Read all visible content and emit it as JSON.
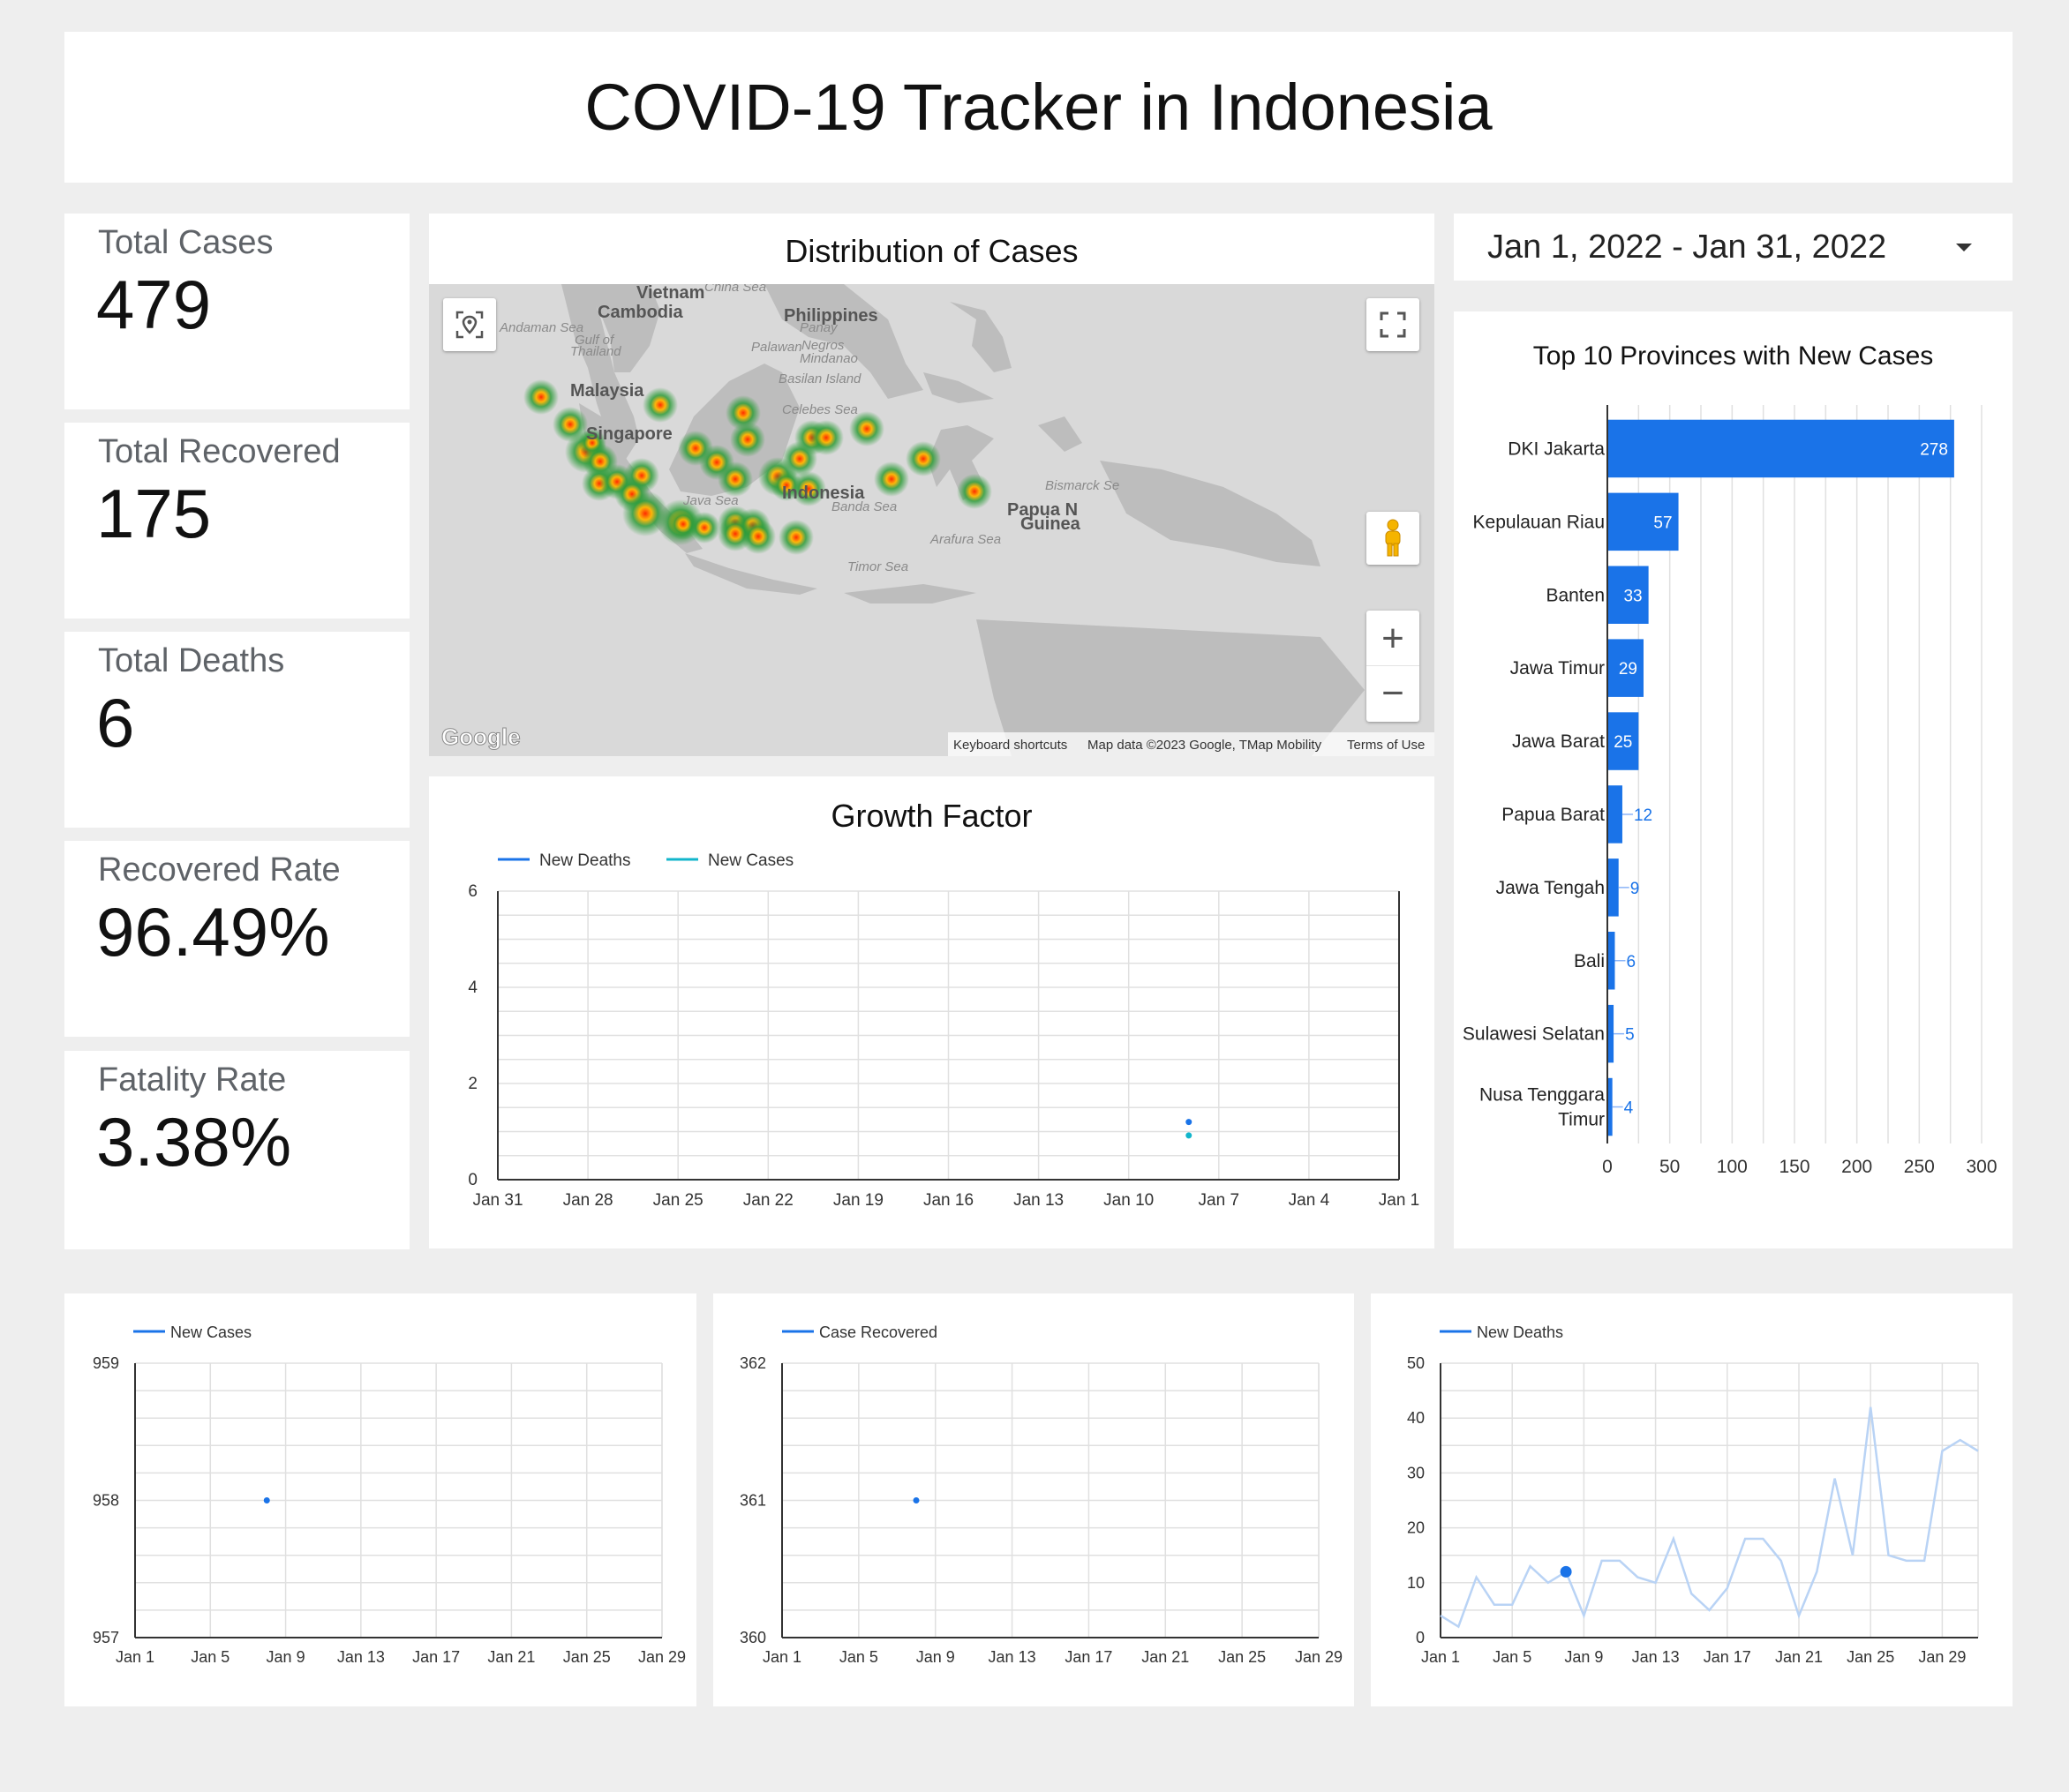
{
  "header": {
    "title": "COVID-19 Tracker in Indonesia"
  },
  "kpis": [
    {
      "label": "Total Cases",
      "value": "479"
    },
    {
      "label": "Total Recovered",
      "value": "175"
    },
    {
      "label": "Total Deaths",
      "value": "6"
    },
    {
      "label": "Recovered Rate",
      "value": "96.49%"
    },
    {
      "label": "Fatality Rate",
      "value": "3.38%"
    }
  ],
  "map": {
    "title": "Distribution of Cases",
    "labels": {
      "vietnam": "Vietnam",
      "china_sea": "China Sea",
      "cambodia": "Cambodia",
      "philippines": "Philippines",
      "andaman": "Andaman Sea",
      "gulf1": "Gulf of",
      "gulf2": "Thailand",
      "panay": "Panay",
      "palawan": "Palawan",
      "negros": "Negros",
      "mindanao": "Mindanao",
      "basilan": "Basilan Island",
      "malaysia": "Malaysia",
      "celebes": "Celebes Sea",
      "singapore": "Singapore",
      "indonesia": "Indonesia",
      "java_sea": "Java Sea",
      "banda": "Banda Sea",
      "bismarck": "Bismarck Se",
      "papua1": "Papua N",
      "papua2": "Guinea",
      "arafura": "Arafura Sea",
      "timor": "Timor Sea"
    },
    "attribution": {
      "logo": "Google",
      "shortcuts": "Keyboard shortcuts",
      "data": "Map data ©2023 Google, TMap Mobility",
      "terms": "Terms of Use"
    },
    "controls": {
      "zoom_in": "+",
      "zoom_out": "−"
    },
    "icons": [
      "locate-icon",
      "fullscreen-icon",
      "pegman-icon"
    ]
  },
  "date_range": {
    "value": "Jan 1, 2022 - Jan 31, 2022",
    "icon": "dropdown-arrow-icon"
  },
  "chart_data": [
    {
      "type": "scatter",
      "title": "Growth Factor",
      "legend": [
        "New Deaths",
        "New Cases"
      ],
      "legend_placement": "top-left",
      "colors": {
        "New Deaths": "#1a73e8",
        "New Cases": "#12b5cb"
      },
      "x_ticks": [
        "Jan 31",
        "Jan 28",
        "Jan 25",
        "Jan 22",
        "Jan 19",
        "Jan 16",
        "Jan 13",
        "Jan 10",
        "Jan 7",
        "Jan 4",
        "Jan 1"
      ],
      "y_ticks": [
        "0",
        "2",
        "4",
        "6"
      ],
      "ylim": [
        0,
        6
      ],
      "xlim": [
        "2022-01-31",
        "2022-01-01"
      ],
      "grid": true,
      "series": [
        {
          "name": "New Deaths",
          "points": [
            {
              "x": "2022-01-08",
              "y": 1.2
            }
          ]
        },
        {
          "name": "New Cases",
          "points": [
            {
              "x": "2022-01-08",
              "y": 0.92
            }
          ]
        }
      ]
    },
    {
      "type": "bar",
      "orientation": "horizontal",
      "title": "Top 10 Provinces with New Cases",
      "color": "#1a73e8",
      "categories": [
        "DKI Jakarta",
        "Kepulauan Riau",
        "Banten",
        "Jawa Timur",
        "Jawa Barat",
        "Papua Barat",
        "Jawa Tengah",
        "Bali",
        "Sulawesi Selatan",
        "Nusa Tenggara Timur"
      ],
      "values": [
        278,
        57,
        33,
        29,
        25,
        12,
        9,
        6,
        5,
        4
      ],
      "x_ticks": [
        "0",
        "50",
        "100",
        "150",
        "200",
        "250",
        "300"
      ],
      "xlim": [
        0,
        300
      ],
      "grid": true
    },
    {
      "type": "line",
      "legend": [
        "New Cases"
      ],
      "color": "#1a73e8",
      "x_ticks": [
        "Jan 1",
        "Jan 5",
        "Jan 9",
        "Jan 13",
        "Jan 17",
        "Jan 21",
        "Jan 25",
        "Jan 29"
      ],
      "y_ticks": [
        "957",
        "958",
        "959"
      ],
      "ylim": [
        957,
        959
      ],
      "xlim": [
        "2022-01-01",
        "2022-01-29"
      ],
      "grid": true,
      "series": [
        {
          "name": "New Cases",
          "points": [
            {
              "x": "2022-01-08",
              "y": 958
            }
          ]
        }
      ]
    },
    {
      "type": "line",
      "legend": [
        "Case Recovered"
      ],
      "color": "#1a73e8",
      "x_ticks": [
        "Jan 1",
        "Jan 5",
        "Jan 9",
        "Jan 13",
        "Jan 17",
        "Jan 21",
        "Jan 25",
        "Jan 29"
      ],
      "y_ticks": [
        "360",
        "361",
        "362"
      ],
      "ylim": [
        360,
        362
      ],
      "xlim": [
        "2022-01-01",
        "2022-01-29"
      ],
      "grid": true,
      "series": [
        {
          "name": "Case Recovered",
          "points": [
            {
              "x": "2022-01-08",
              "y": 361
            }
          ]
        }
      ]
    },
    {
      "type": "line",
      "legend": [
        "New Deaths"
      ],
      "color": "#1a73e8",
      "context_color": "#b9d3f5",
      "x_ticks": [
        "Jan 1",
        "Jan 5",
        "Jan 9",
        "Jan 13",
        "Jan 17",
        "Jan 21",
        "Jan 25",
        "Jan 29"
      ],
      "y_ticks": [
        "0",
        "10",
        "20",
        "30",
        "40",
        "50"
      ],
      "ylim": [
        0,
        50
      ],
      "xlim": [
        "2022-01-01",
        "2022-01-31"
      ],
      "grid": true,
      "highlight": {
        "x": "2022-01-08",
        "y": 12
      },
      "series": [
        {
          "name": "New Deaths",
          "values": [
            4,
            2,
            11,
            6,
            6,
            13,
            10,
            12,
            4,
            14,
            14,
            11,
            10,
            18,
            8,
            5,
            9,
            18,
            18,
            14,
            4,
            12,
            29,
            15,
            42,
            15,
            14,
            14,
            34,
            36,
            34
          ]
        }
      ]
    }
  ]
}
